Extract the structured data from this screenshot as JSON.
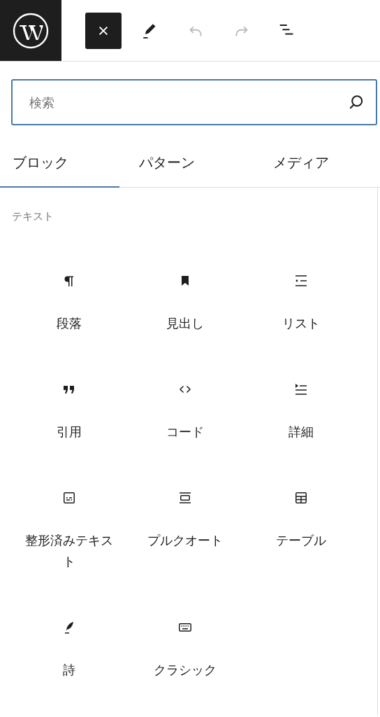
{
  "toolbar": [
    {
      "kind": "close",
      "pressed": true,
      "disabled": false
    },
    {
      "kind": "edit",
      "pressed": false,
      "disabled": false
    },
    {
      "kind": "undo",
      "pressed": false,
      "disabled": true
    },
    {
      "kind": "redo",
      "pressed": false,
      "disabled": true
    },
    {
      "kind": "list-view",
      "pressed": false,
      "disabled": false
    }
  ],
  "search": {
    "placeholder": "検索"
  },
  "tabs": [
    {
      "label": "ブロック",
      "selected": true
    },
    {
      "label": "パターン",
      "selected": false
    },
    {
      "label": "メディア",
      "selected": false
    }
  ],
  "category": {
    "title": "テキスト",
    "blocks": [
      {
        "kind": "paragraph",
        "label": "段落"
      },
      {
        "kind": "heading",
        "label": "見出し"
      },
      {
        "kind": "list",
        "label": "リスト"
      },
      {
        "kind": "quote",
        "label": "引用"
      },
      {
        "kind": "code",
        "label": "コード"
      },
      {
        "kind": "details",
        "label": "詳細"
      },
      {
        "kind": "preformatted",
        "label": "整形済みテキスト"
      },
      {
        "kind": "pullquote",
        "label": "プルクオート"
      },
      {
        "kind": "table",
        "label": "テーブル"
      },
      {
        "kind": "verse",
        "label": "詩"
      },
      {
        "kind": "classic",
        "label": "クラシック"
      }
    ]
  }
}
